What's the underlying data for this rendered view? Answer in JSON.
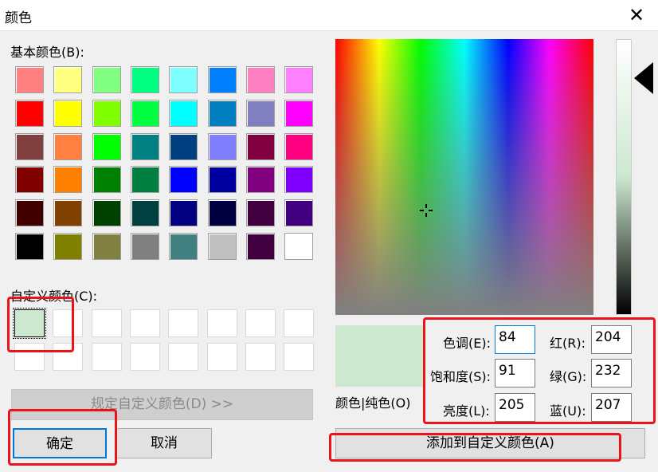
{
  "title": "颜色",
  "close_symbol": "✕",
  "basic_colors_label": "基本颜色(B):",
  "custom_colors_label": "自定义颜色(C):",
  "basic_colors": [
    "#ff8080",
    "#ffff80",
    "#80ff80",
    "#00ff80",
    "#80ffff",
    "#0080ff",
    "#ff80c0",
    "#ff80ff",
    "#ff0000",
    "#ffff00",
    "#80ff00",
    "#00ff40",
    "#00ffff",
    "#0080c0",
    "#8080c0",
    "#ff00ff",
    "#804040",
    "#ff8040",
    "#00ff00",
    "#008080",
    "#004080",
    "#8080ff",
    "#800040",
    "#ff0080",
    "#800000",
    "#ff8000",
    "#008000",
    "#008040",
    "#0000ff",
    "#0000a0",
    "#800080",
    "#8000ff",
    "#400000",
    "#804000",
    "#004000",
    "#004040",
    "#000080",
    "#000040",
    "#400040",
    "#400080",
    "#000000",
    "#808000",
    "#808040",
    "#808080",
    "#408080",
    "#c0c0c0",
    "#400040",
    "#ffffff"
  ],
  "custom_colors": [
    "#cce8cf",
    "#ffffff",
    "#ffffff",
    "#ffffff",
    "#ffffff",
    "#ffffff",
    "#ffffff",
    "#ffffff",
    "#ffffff",
    "#ffffff",
    "#ffffff",
    "#ffffff",
    "#ffffff",
    "#ffffff",
    "#ffffff",
    "#ffffff"
  ],
  "define_custom_button": "规定自定义颜色(D) >>",
  "ok_button": "确定",
  "cancel_button": "取消",
  "color_solid_label": "颜色|纯色(O)",
  "preview_color": "#cce8cf",
  "fields": {
    "hue_label": "色调(E):",
    "hue_value": "84",
    "sat_label": "饱和度(S):",
    "sat_value": "91",
    "lum_label": "亮度(L):",
    "lum_value": "205",
    "red_label": "红(R):",
    "red_value": "204",
    "green_label": "绿(G):",
    "green_value": "232",
    "blue_label": "蓝(U):",
    "blue_value": "207"
  },
  "add_custom_button": "添加到自定义颜色(A)",
  "highlight_color": "#e8131b"
}
